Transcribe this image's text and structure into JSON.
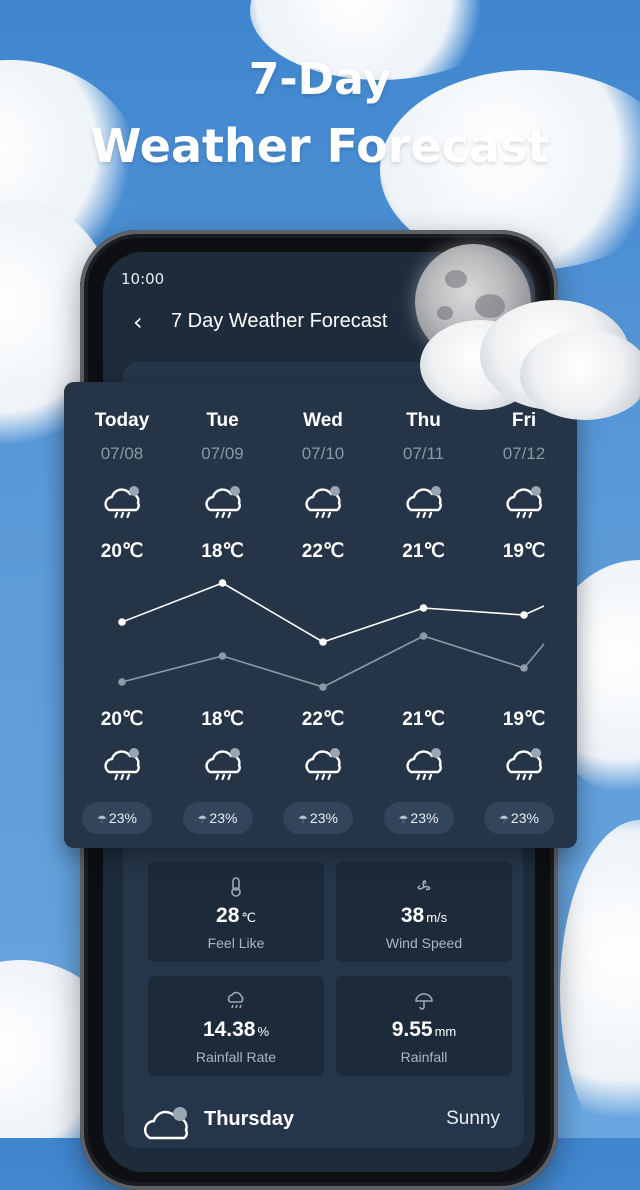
{
  "promo": {
    "line1": "7-Day",
    "line2": "Weather Forecast"
  },
  "status": {
    "time": "10:00"
  },
  "nav": {
    "back_glyph": "‹",
    "title": "7 Day Weather Forecast"
  },
  "forecast": [
    {
      "day": "Today",
      "date": "07/08",
      "high": "20℃",
      "low": "20℃",
      "high_value": 20,
      "low_value": 20,
      "icon": "rain-cloud-icon",
      "precip": "23%"
    },
    {
      "day": "Tue",
      "date": "07/09",
      "high": "18℃",
      "low": "18℃",
      "high_value": 18,
      "low_value": 18,
      "icon": "rain-cloud-icon",
      "precip": "23%"
    },
    {
      "day": "Wed",
      "date": "07/10",
      "high": "22℃",
      "low": "22℃",
      "high_value": 22,
      "low_value": 22,
      "icon": "rain-cloud-icon",
      "precip": "23%"
    },
    {
      "day": "Thu",
      "date": "07/11",
      "high": "21℃",
      "low": "21℃",
      "high_value": 21,
      "low_value": 21,
      "icon": "rain-cloud-icon",
      "precip": "23%"
    },
    {
      "day": "Fri",
      "date": "07/12",
      "high": "19℃",
      "low": "19℃",
      "high_value": 19,
      "low_value": 19,
      "icon": "rain-cloud-icon",
      "precip": "23%"
    }
  ],
  "details": {
    "feel": {
      "value": "28",
      "unit": "℃",
      "label": "Feel Like",
      "icon": "thermometer-icon"
    },
    "wind": {
      "value": "38",
      "unit": "m/s",
      "label": "Wind Speed",
      "icon": "wind-icon"
    },
    "rain_rate": {
      "value": "14.38",
      "unit": "%",
      "label": "Rainfall Rate",
      "icon": "rain-cloud-icon"
    },
    "rainfall": {
      "value": "9.55",
      "unit": "mm",
      "label": "Rainfall",
      "icon": "umbrella-icon"
    }
  },
  "bottom": {
    "day": "Thursday",
    "condition": "Sunny",
    "icon": "cloud-icon"
  },
  "colors": {
    "card": "#253447",
    "screen": "#1e2b3b",
    "line_high": "#ffffff",
    "line_low": "#8d9aa8"
  }
}
